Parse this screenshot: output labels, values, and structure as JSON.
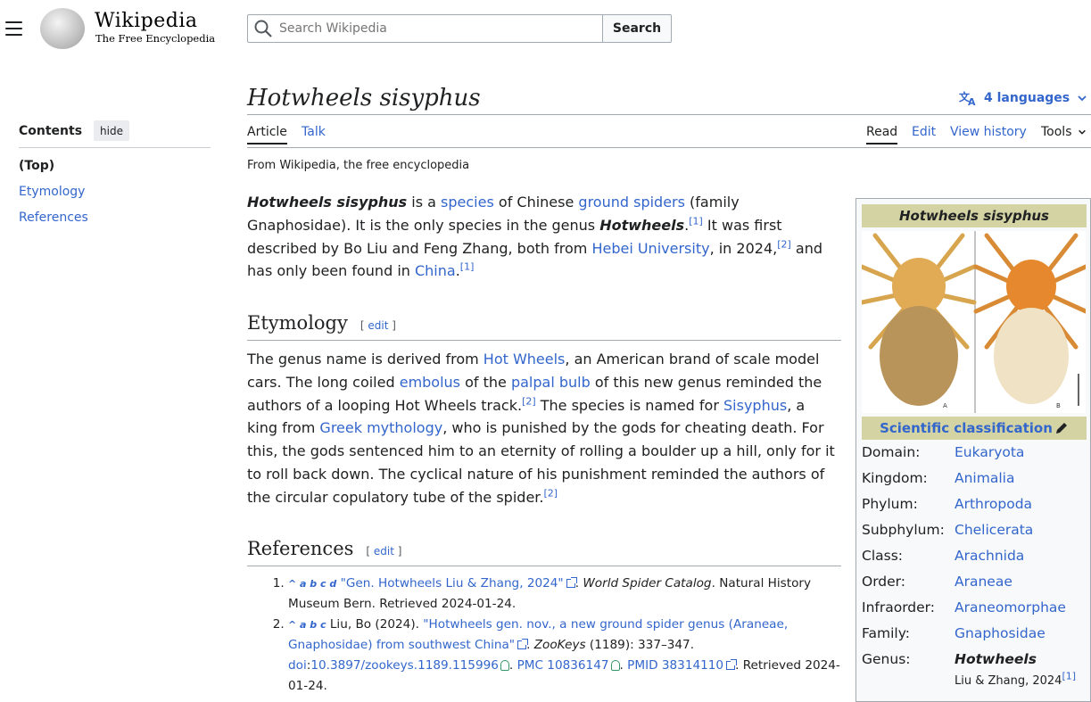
{
  "header": {
    "logo_word": "Wikipedia",
    "logo_tagline": "The Free Encyclopedia",
    "search_placeholder": "Search Wikipedia",
    "search_button": "Search"
  },
  "toc": {
    "title": "Contents",
    "hide_label": "hide",
    "items": [
      "(Top)",
      "Etymology",
      "References"
    ]
  },
  "page": {
    "title": "Hotwheels sisyphus",
    "languages": "4 languages",
    "tabs_left": [
      "Article",
      "Talk"
    ],
    "tabs_right": [
      "Read",
      "Edit",
      "View history",
      "Tools"
    ],
    "from": "From Wikipedia, the free encyclopedia"
  },
  "intro": {
    "p1a": "Hotwheels sisyphus",
    "p1b": " is a ",
    "l_species": "species",
    "p1c": " of Chinese ",
    "l_ground": "ground spiders",
    "p1d": " (family Gnaphosidae). It is the only species in the genus ",
    "p1e": "Hotwheels",
    "p1f": ".",
    "ref1": "[1]",
    "p1g": " It was first described by Bo Liu and Feng Zhang, both from ",
    "l_hebei": "Hebei University",
    "p1h": ", in 2024,",
    "ref2": "[2]",
    "p1i": " and has only been found in ",
    "l_china": "China",
    "p1j": ".",
    "ref3": "[1]"
  },
  "etymology": {
    "heading": "Etymology",
    "edit": "edit",
    "t1": "The genus name is derived from ",
    "l1": "Hot Wheels",
    "t2": ", an American brand of scale model cars. The long coiled ",
    "l2": "embolus",
    "t3": " of the ",
    "l3": "palpal bulb",
    "t4": " of this new genus reminded the authors of a looping Hot Wheels track.",
    "r1": "[2]",
    "t5": " The species is named for ",
    "l4": "Sisyphus",
    "t6": ", a king from ",
    "l5": "Greek mythology",
    "t7": ", who is punished by the gods for cheating death. For this, the gods sentenced him to an eternity of rolling a boulder up a hill, only for it to roll back down. The cyclical nature of his punishment reminded the authors of the circular copulatory tube of the spider.",
    "r2": "[2]"
  },
  "references": {
    "heading": "References",
    "edit": "edit",
    "ref1_back": "^ a b c d",
    "ref1_link": "\"Gen. Hotwheels Liu & Zhang, 2024\"",
    "ref1_source": "World Spider Catalog",
    "ref1_rest": ". Natural History Museum Bern. Retrieved 2024-01-24.",
    "ref2_back": "^ a b c",
    "ref2_author": "Liu, Bo (2024). ",
    "ref2_link": "\"Hotwheels gen. nov., a new ground spider genus (Araneae, Gnaphosidae) from southwest China\"",
    "ref2_journal": "ZooKeys",
    "ref2_vol": " (1189): 337–347. ",
    "ref2_doi_label": "doi",
    "ref2_doi": "10.3897/zookeys.1189.115996",
    "ref2_pmc": "PMC 10836147",
    "ref2_pmid": "PMID 38314110",
    "ref2_retrieved": ". Retrieved 2024-01-24."
  },
  "infobox": {
    "title": "Hotwheels sisyphus",
    "classification": "Scientific classification",
    "rows": [
      {
        "label": "Domain:",
        "value": "Eukaryota"
      },
      {
        "label": "Kingdom:",
        "value": "Animalia"
      },
      {
        "label": "Phylum:",
        "value": "Arthropoda"
      },
      {
        "label": "Subphylum:",
        "value": "Chelicerata"
      },
      {
        "label": "Class:",
        "value": "Arachnida"
      },
      {
        "label": "Order:",
        "value": "Araneae"
      },
      {
        "label": "Infraorder:",
        "value": "Araneomorphae"
      },
      {
        "label": "Family:",
        "value": "Gnaphosidae"
      }
    ],
    "genus_label": "Genus:",
    "genus_value": "Hotwheels",
    "genus_authority": "Liu & Zhang, 2024",
    "genus_ref": "[1]",
    "image_labels": [
      "A",
      "B"
    ]
  }
}
